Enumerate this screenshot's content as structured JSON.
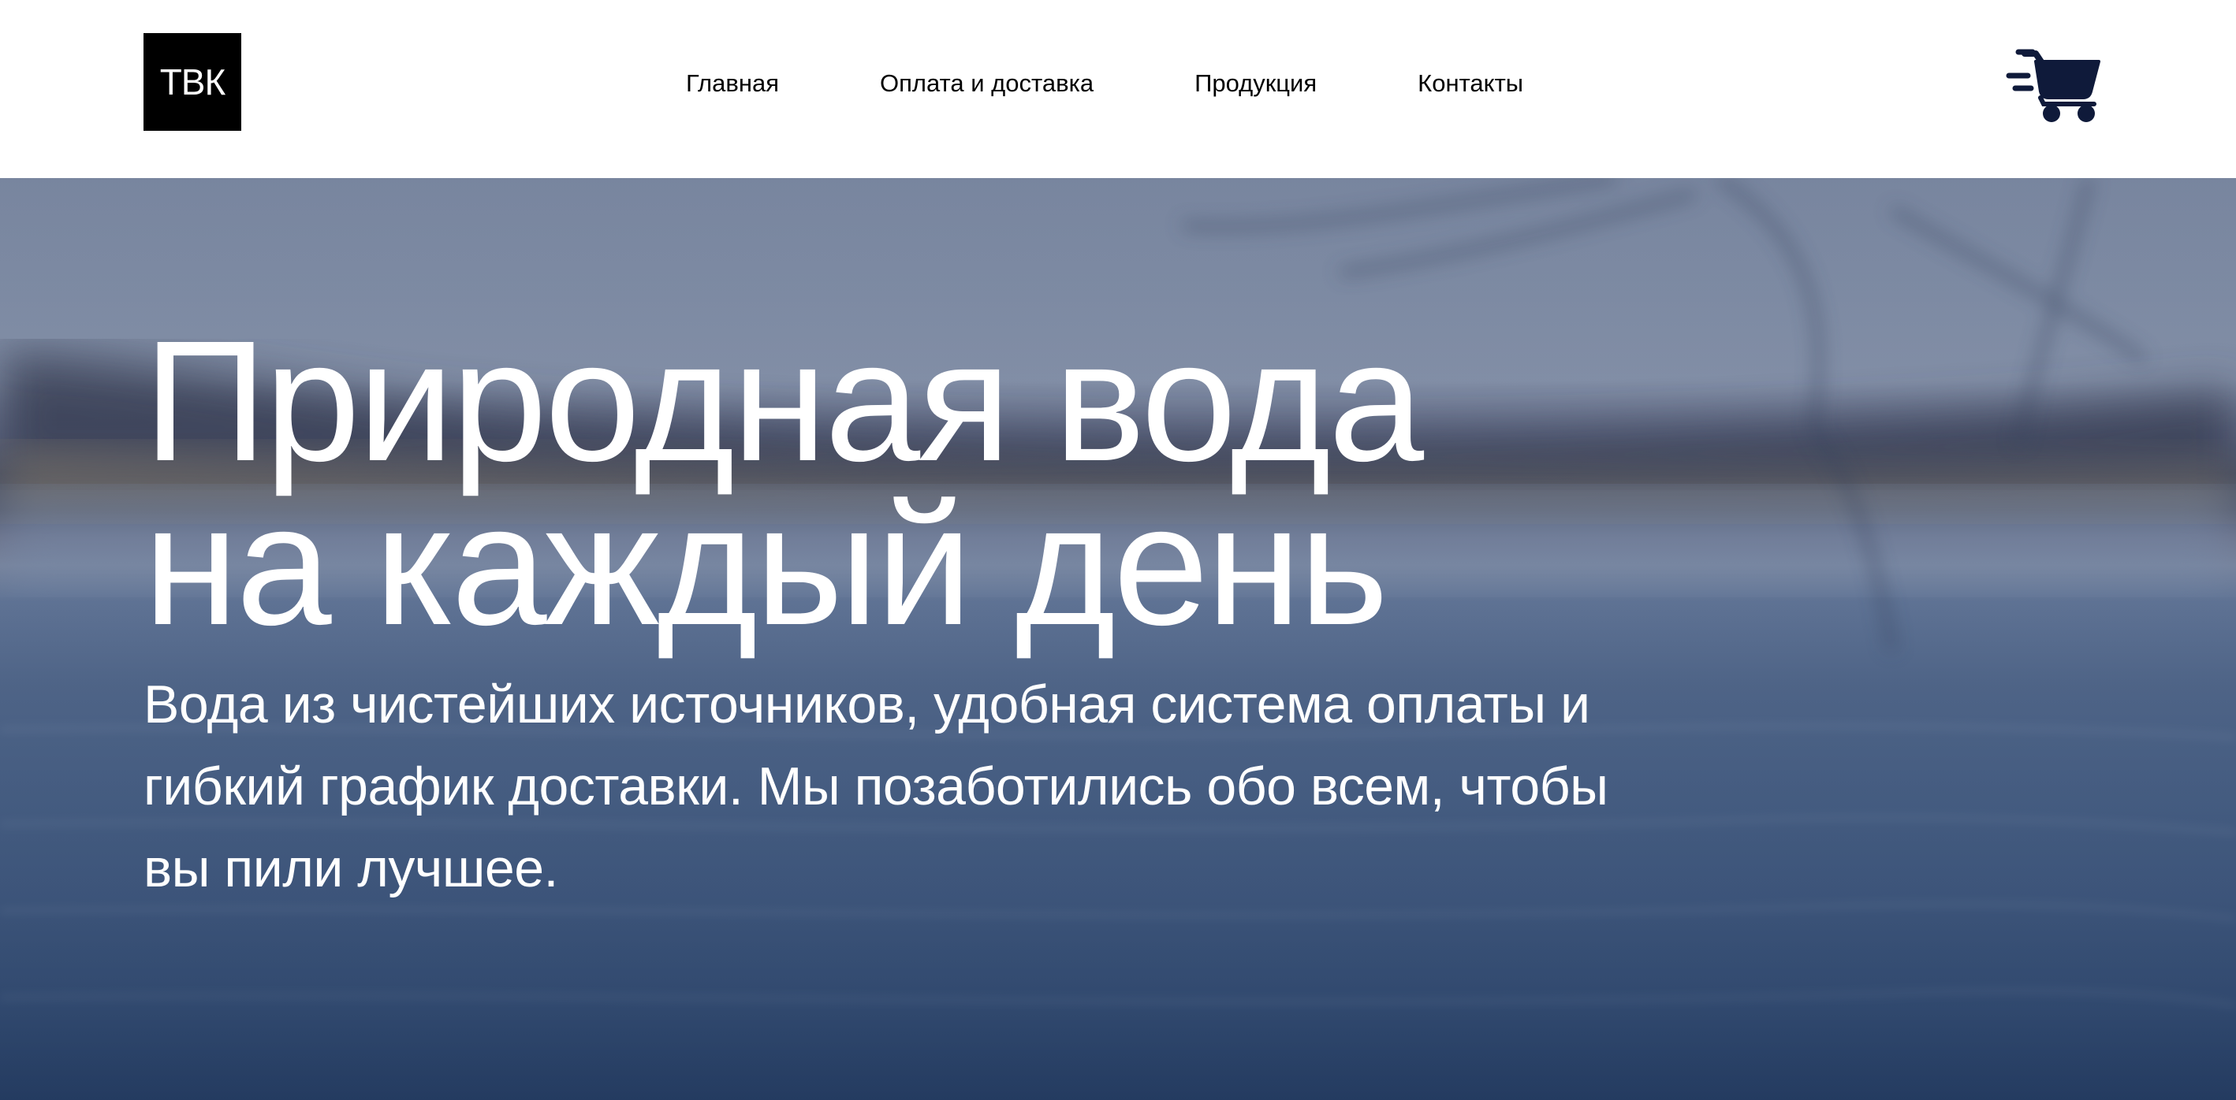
{
  "header": {
    "logo_text": "ТВК",
    "nav": [
      {
        "label": "Главная"
      },
      {
        "label": "Оплата и доставка"
      },
      {
        "label": "Продукция"
      },
      {
        "label": "Контакты"
      }
    ],
    "cart_icon": "shopping-cart-fast-icon"
  },
  "hero": {
    "title_line1": "Природная вода",
    "title_line2": "на каждый день",
    "text": "Вода из чистейших источников, удобная система оплаты и гибкий график доставки. Мы позаботились обо всем, чтобы вы пили лучшее."
  },
  "colors": {
    "accent": "#0f1a3a",
    "logo_bg": "#000000",
    "header_bg": "#ffffff",
    "hero_text": "#ffffff"
  }
}
